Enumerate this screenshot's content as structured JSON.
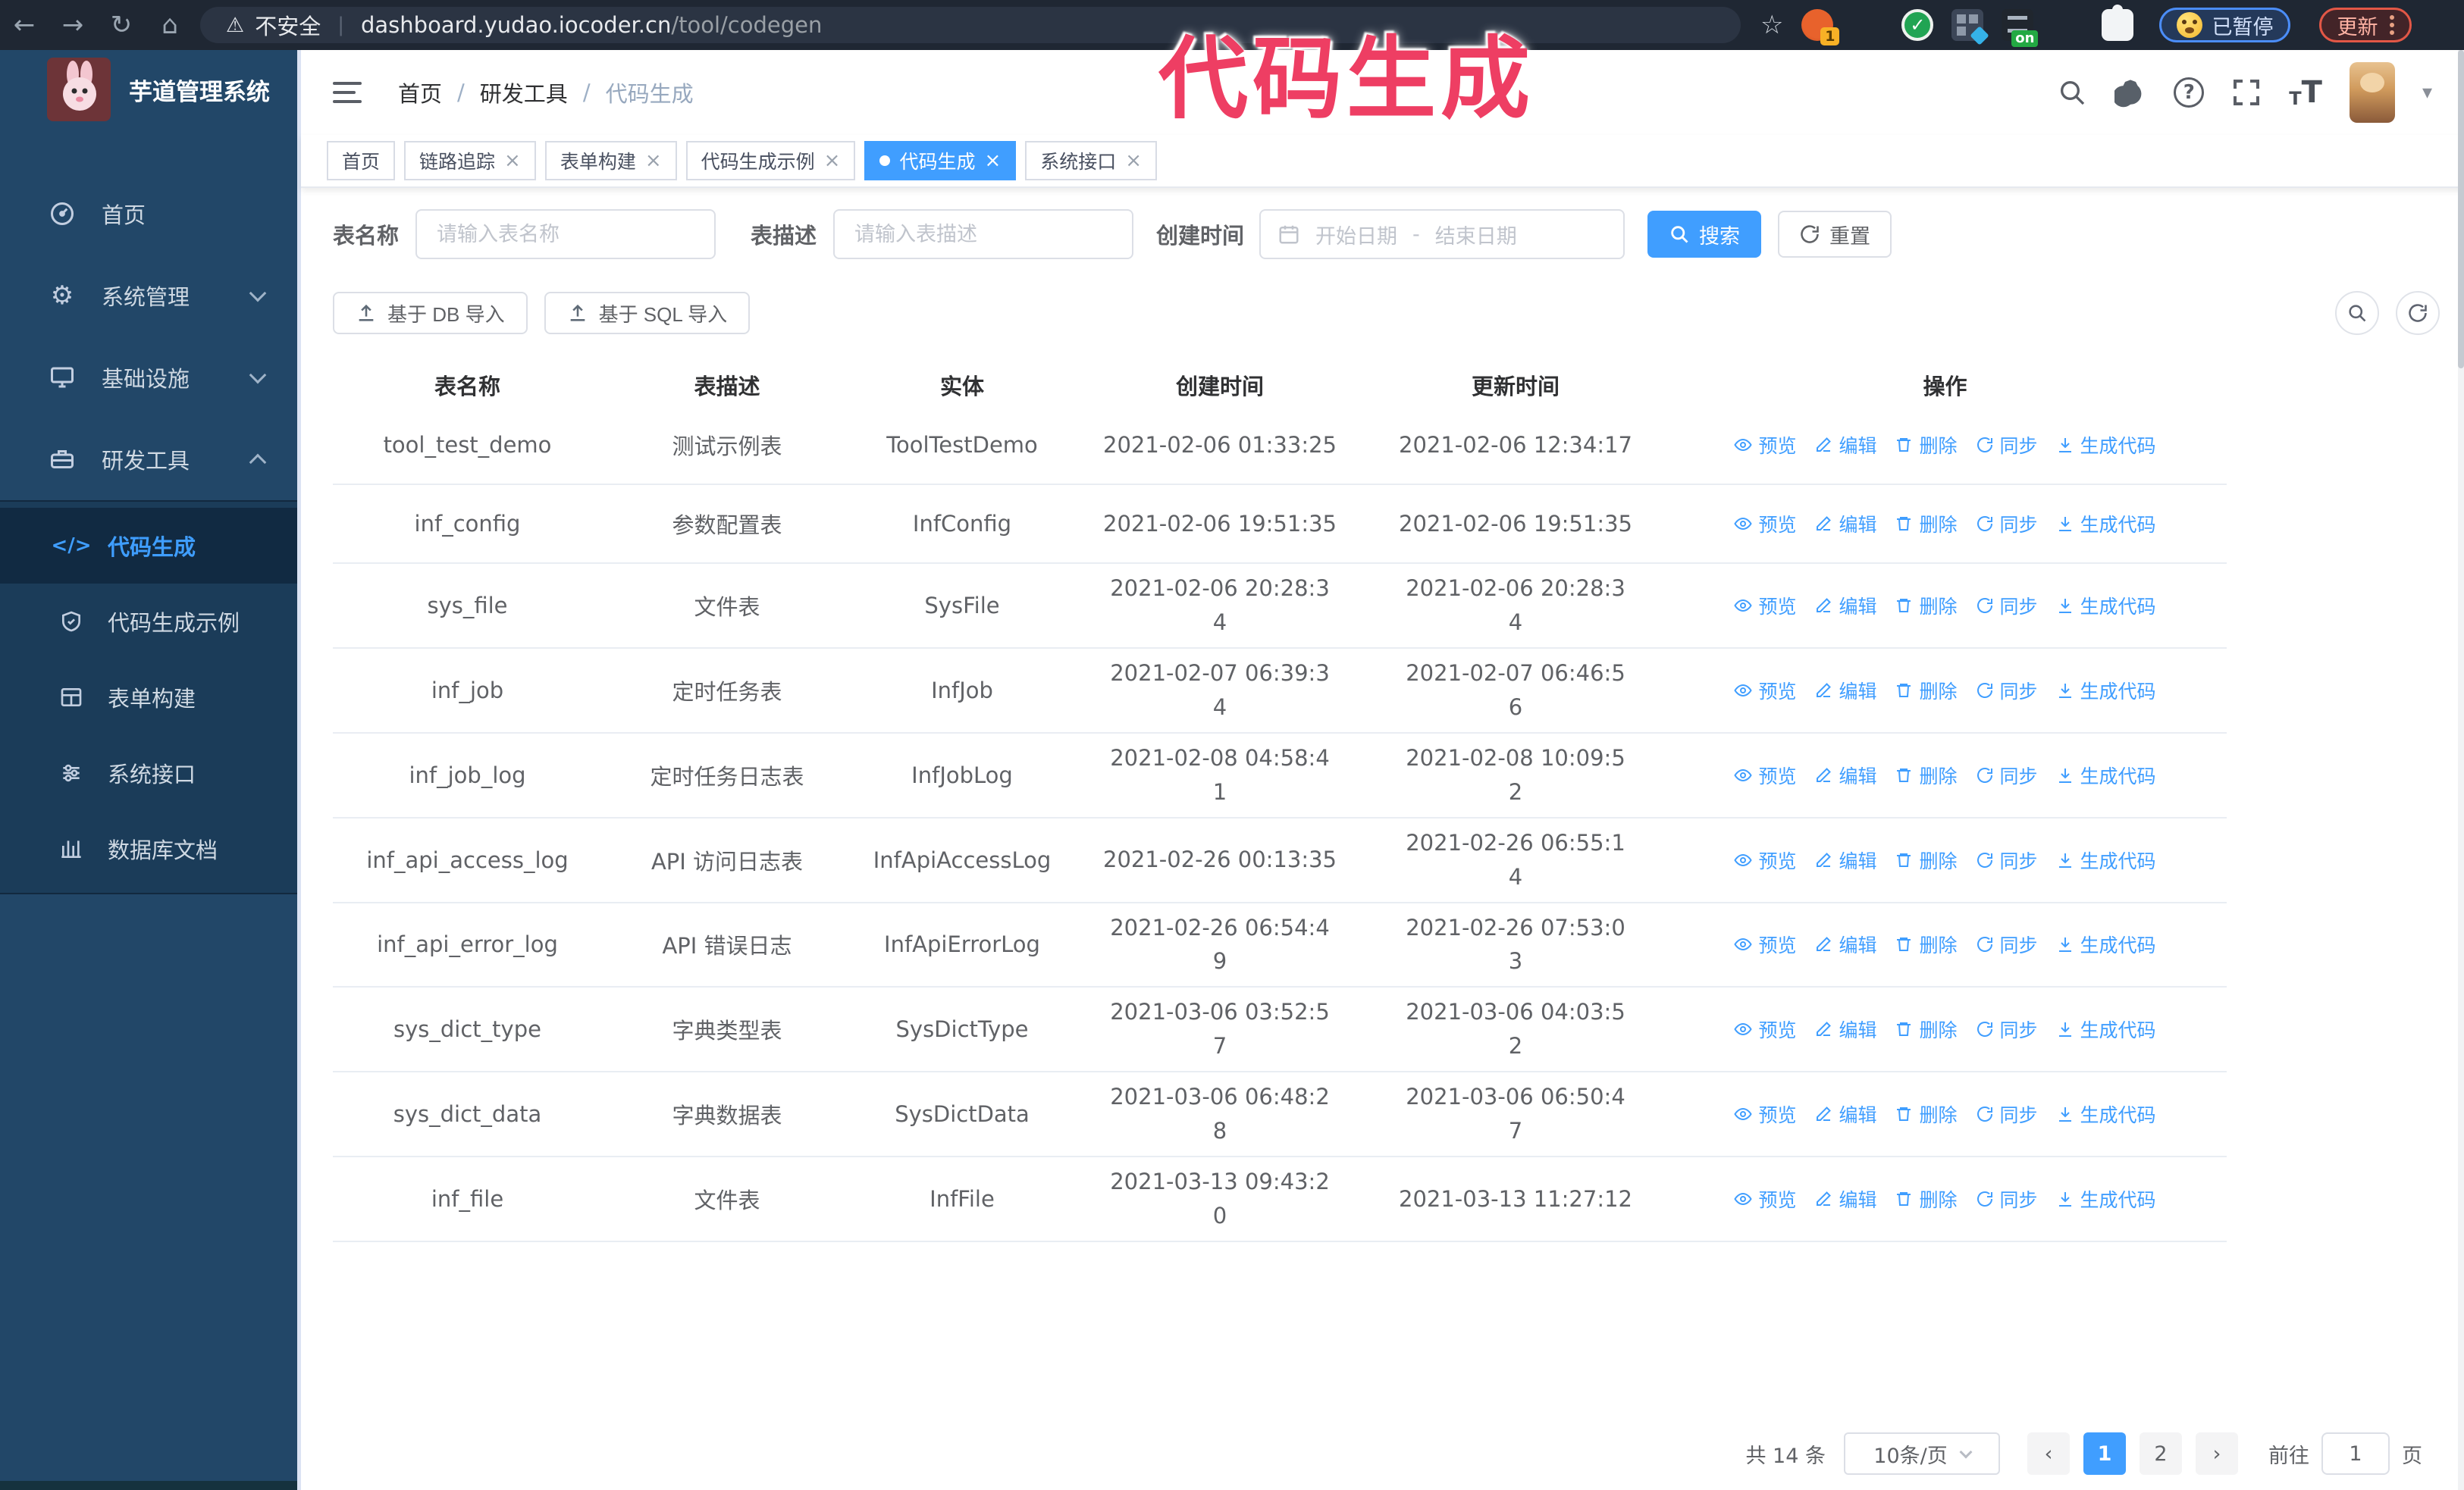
{
  "browser": {
    "security_label": "不安全",
    "url_domain": "dashboard.yudao.iocoder.cn",
    "url_path": "/tool/codegen",
    "paused_badge": "已暂停",
    "update_badge": "更新",
    "extension_badge": "1",
    "extension_on": "on"
  },
  "overlay": {
    "title": "代码生成",
    "color": "#ee3e63"
  },
  "icons": {
    "back": "←",
    "forward": "→",
    "reload": "↻",
    "home": "⌂",
    "warning": "⚠",
    "star": "☆",
    "url_separator": "|",
    "close": "×",
    "breadcrumb_separator": "/",
    "question": "?",
    "font_large": "T",
    "font_small": "T",
    "caret_down": "▾",
    "gear": "⚙",
    "code": "</>",
    "prev": "‹",
    "next": "›"
  },
  "sidebar": {
    "logo_title": "芋道管理系统",
    "menu": [
      {
        "label": "首页"
      },
      {
        "label": "系统管理"
      },
      {
        "label": "基础设施"
      },
      {
        "label": "研发工具"
      }
    ],
    "submenu": [
      {
        "label": "代码生成"
      },
      {
        "label": "代码生成示例"
      },
      {
        "label": "表单构建"
      },
      {
        "label": "系统接口"
      },
      {
        "label": "数据库文档"
      }
    ]
  },
  "header": {
    "breadcrumb": [
      "首页",
      "研发工具",
      "代码生成"
    ]
  },
  "tabs": [
    {
      "label": "首页"
    },
    {
      "label": "链路追踪"
    },
    {
      "label": "表单构建"
    },
    {
      "label": "代码生成示例"
    },
    {
      "label": "代码生成"
    },
    {
      "label": "系统接口"
    }
  ],
  "search": {
    "name_label": "表名称",
    "name_placeholder": "请输入表名称",
    "desc_label": "表描述",
    "desc_placeholder": "请输入表描述",
    "time_label": "创建时间",
    "start_placeholder": "开始日期",
    "range_separator": "-",
    "end_placeholder": "结束日期",
    "search_label": "搜索",
    "reset_label": "重置"
  },
  "toolbar": {
    "db_import_label": "基于 DB 导入",
    "sql_import_label": "基于 SQL 导入"
  },
  "table": {
    "columns": [
      "表名称",
      "表描述",
      "实体",
      "创建时间",
      "更新时间",
      "操作"
    ],
    "actions": [
      "预览",
      "编辑",
      "删除",
      "同步",
      "生成代码"
    ],
    "rows": [
      {
        "name": "tool_test_demo",
        "desc": "测试示例表",
        "entity": "ToolTestDemo",
        "created": "2021-02-06 01:33:25",
        "updated": "2021-02-06 12:34:17"
      },
      {
        "name": "inf_config",
        "desc": "参数配置表",
        "entity": "InfConfig",
        "created": "2021-02-06 19:51:35",
        "updated": "2021-02-06 19:51:35"
      },
      {
        "name": "sys_file",
        "desc": "文件表",
        "entity": "SysFile",
        "created": "2021-02-06 20:28:3\n4",
        "updated": "2021-02-06 20:28:3\n4"
      },
      {
        "name": "inf_job",
        "desc": "定时任务表",
        "entity": "InfJob",
        "created": "2021-02-07 06:39:3\n4",
        "updated": "2021-02-07 06:46:5\n6"
      },
      {
        "name": "inf_job_log",
        "desc": "定时任务日志表",
        "entity": "InfJobLog",
        "created": "2021-02-08 04:58:4\n1",
        "updated": "2021-02-08 10:09:5\n2"
      },
      {
        "name": "inf_api_access_log",
        "desc": "API 访问日志表",
        "entity": "InfApiAccessLog",
        "created": "2021-02-26 00:13:35",
        "updated": "2021-02-26 06:55:1\n4"
      },
      {
        "name": "inf_api_error_log",
        "desc": "API 错误日志",
        "entity": "InfApiErrorLog",
        "created": "2021-02-26 06:54:4\n9",
        "updated": "2021-02-26 07:53:0\n3"
      },
      {
        "name": "sys_dict_type",
        "desc": "字典类型表",
        "entity": "SysDictType",
        "created": "2021-03-06 03:52:5\n7",
        "updated": "2021-03-06 04:03:5\n2"
      },
      {
        "name": "sys_dict_data",
        "desc": "字典数据表",
        "entity": "SysDictData",
        "created": "2021-03-06 06:48:2\n8",
        "updated": "2021-03-06 06:50:4\n7"
      },
      {
        "name": "inf_file",
        "desc": "文件表",
        "entity": "InfFile",
        "created": "2021-03-13 09:43:2\n0",
        "updated": "2021-03-13 11:27:12"
      }
    ]
  },
  "pagination": {
    "total_label": "共 14 条",
    "page_size_label": "10条/页",
    "pages": [
      "1",
      "2"
    ],
    "active_page": "1",
    "goto_label": "前往",
    "goto_value": "1",
    "page_suffix": "页"
  },
  "colors": {
    "primary": "#409EFF",
    "sidebar_bg": "#224768",
    "submenu_bg": "#1b3c59",
    "annotation_pink": "#ee3e63"
  }
}
